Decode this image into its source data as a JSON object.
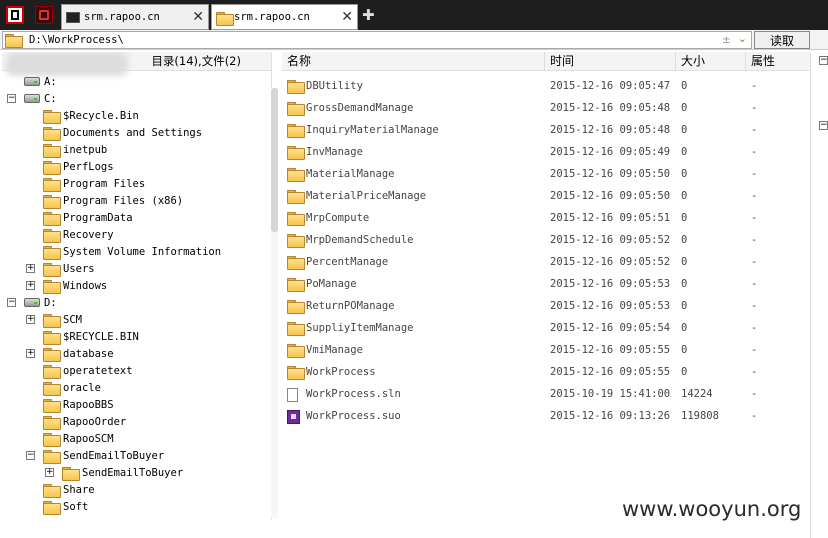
{
  "tabs": [
    {
      "label": "srm.rapoo.cn",
      "active": false
    },
    {
      "label": "srm.rapoo.cn",
      "active": true
    }
  ],
  "address": {
    "value": "D:\\WorkProcess\\",
    "read_label": "读取"
  },
  "tree": {
    "header": "目录(14),文件(2)",
    "items": [
      {
        "label": "A:",
        "kind": "drive",
        "toggle": "",
        "depth": 0
      },
      {
        "label": "C:",
        "kind": "drive",
        "toggle": "−",
        "depth": 0
      },
      {
        "label": "$Recycle.Bin",
        "kind": "folder",
        "toggle": "",
        "depth": 1
      },
      {
        "label": "Documents and Settings",
        "kind": "folder",
        "toggle": "",
        "depth": 1
      },
      {
        "label": "inetpub",
        "kind": "folder",
        "toggle": "",
        "depth": 1
      },
      {
        "label": "PerfLogs",
        "kind": "folder",
        "toggle": "",
        "depth": 1
      },
      {
        "label": "Program Files",
        "kind": "folder",
        "toggle": "",
        "depth": 1
      },
      {
        "label": "Program Files (x86)",
        "kind": "folder",
        "toggle": "",
        "depth": 1
      },
      {
        "label": "ProgramData",
        "kind": "folder",
        "toggle": "",
        "depth": 1
      },
      {
        "label": "Recovery",
        "kind": "folder",
        "toggle": "",
        "depth": 1
      },
      {
        "label": "System Volume Information",
        "kind": "folder",
        "toggle": "",
        "depth": 1
      },
      {
        "label": "Users",
        "kind": "folder",
        "toggle": "+",
        "depth": 1
      },
      {
        "label": "Windows",
        "kind": "folder",
        "toggle": "+",
        "depth": 1
      },
      {
        "label": "D:",
        "kind": "drive",
        "toggle": "−",
        "depth": 0
      },
      {
        "label": "SCM",
        "kind": "folder",
        "toggle": "+",
        "depth": 1
      },
      {
        "label": "$RECYCLE.BIN",
        "kind": "folder",
        "toggle": "",
        "depth": 1
      },
      {
        "label": "database",
        "kind": "folder",
        "toggle": "+",
        "depth": 1
      },
      {
        "label": "operatetext",
        "kind": "folder",
        "toggle": "",
        "depth": 1
      },
      {
        "label": "oracle",
        "kind": "folder",
        "toggle": "",
        "depth": 1
      },
      {
        "label": "RapooBBS",
        "kind": "folder",
        "toggle": "",
        "depth": 1
      },
      {
        "label": "RapooOrder",
        "kind": "folder",
        "toggle": "",
        "depth": 1
      },
      {
        "label": "RapooSCM",
        "kind": "folder",
        "toggle": "",
        "depth": 1
      },
      {
        "label": "SendEmailToBuyer",
        "kind": "folder",
        "toggle": "−",
        "depth": 1
      },
      {
        "label": "SendEmailToBuyer",
        "kind": "folder",
        "toggle": "+",
        "depth": 2
      },
      {
        "label": "Share",
        "kind": "folder",
        "toggle": "",
        "depth": 1
      },
      {
        "label": "Soft",
        "kind": "folder",
        "toggle": "",
        "depth": 1
      }
    ]
  },
  "list": {
    "columns": [
      "名称",
      "时间",
      "大小",
      "属性"
    ],
    "rows": [
      {
        "name": "DBUtility",
        "time": "2015-12-16 09:05:47",
        "size": "0",
        "attr": "-",
        "icon": "folder-icon"
      },
      {
        "name": "GrossDemandManage",
        "time": "2015-12-16 09:05:48",
        "size": "0",
        "attr": "-",
        "icon": "folder-icon"
      },
      {
        "name": "InquiryMaterialManage",
        "time": "2015-12-16 09:05:48",
        "size": "0",
        "attr": "-",
        "icon": "folder-icon"
      },
      {
        "name": "InvManage",
        "time": "2015-12-16 09:05:49",
        "size": "0",
        "attr": "-",
        "icon": "folder-icon"
      },
      {
        "name": "MaterialManage",
        "time": "2015-12-16 09:05:50",
        "size": "0",
        "attr": "-",
        "icon": "folder-icon"
      },
      {
        "name": "MaterialPriceManage",
        "time": "2015-12-16 09:05:50",
        "size": "0",
        "attr": "-",
        "icon": "folder-icon"
      },
      {
        "name": "MrpCompute",
        "time": "2015-12-16 09:05:51",
        "size": "0",
        "attr": "-",
        "icon": "folder-icon"
      },
      {
        "name": "MrpDemandSchedule",
        "time": "2015-12-16 09:05:52",
        "size": "0",
        "attr": "-",
        "icon": "folder-icon"
      },
      {
        "name": "PercentManage",
        "time": "2015-12-16 09:05:52",
        "size": "0",
        "attr": "-",
        "icon": "folder-icon"
      },
      {
        "name": "PoManage",
        "time": "2015-12-16 09:05:53",
        "size": "0",
        "attr": "-",
        "icon": "folder-icon"
      },
      {
        "name": "ReturnPOManage",
        "time": "2015-12-16 09:05:53",
        "size": "0",
        "attr": "-",
        "icon": "folder-icon"
      },
      {
        "name": "SuppliyItemManage",
        "time": "2015-12-16 09:05:54",
        "size": "0",
        "attr": "-",
        "icon": "folder-icon"
      },
      {
        "name": "VmiManage",
        "time": "2015-12-16 09:05:55",
        "size": "0",
        "attr": "-",
        "icon": "folder-icon"
      },
      {
        "name": "WorkProcess",
        "time": "2015-12-16 09:05:55",
        "size": "0",
        "attr": "-",
        "icon": "folder-icon"
      },
      {
        "name": "WorkProcess.sln",
        "time": "2015-10-19 15:41:00",
        "size": "14224",
        "attr": "-",
        "icon": "document-icon"
      },
      {
        "name": "WorkProcess.suo",
        "time": "2015-12-16 09:13:26",
        "size": "119808",
        "attr": "-",
        "icon": "vs-suo-icon"
      }
    ]
  },
  "watermark": "www.wooyun.org"
}
